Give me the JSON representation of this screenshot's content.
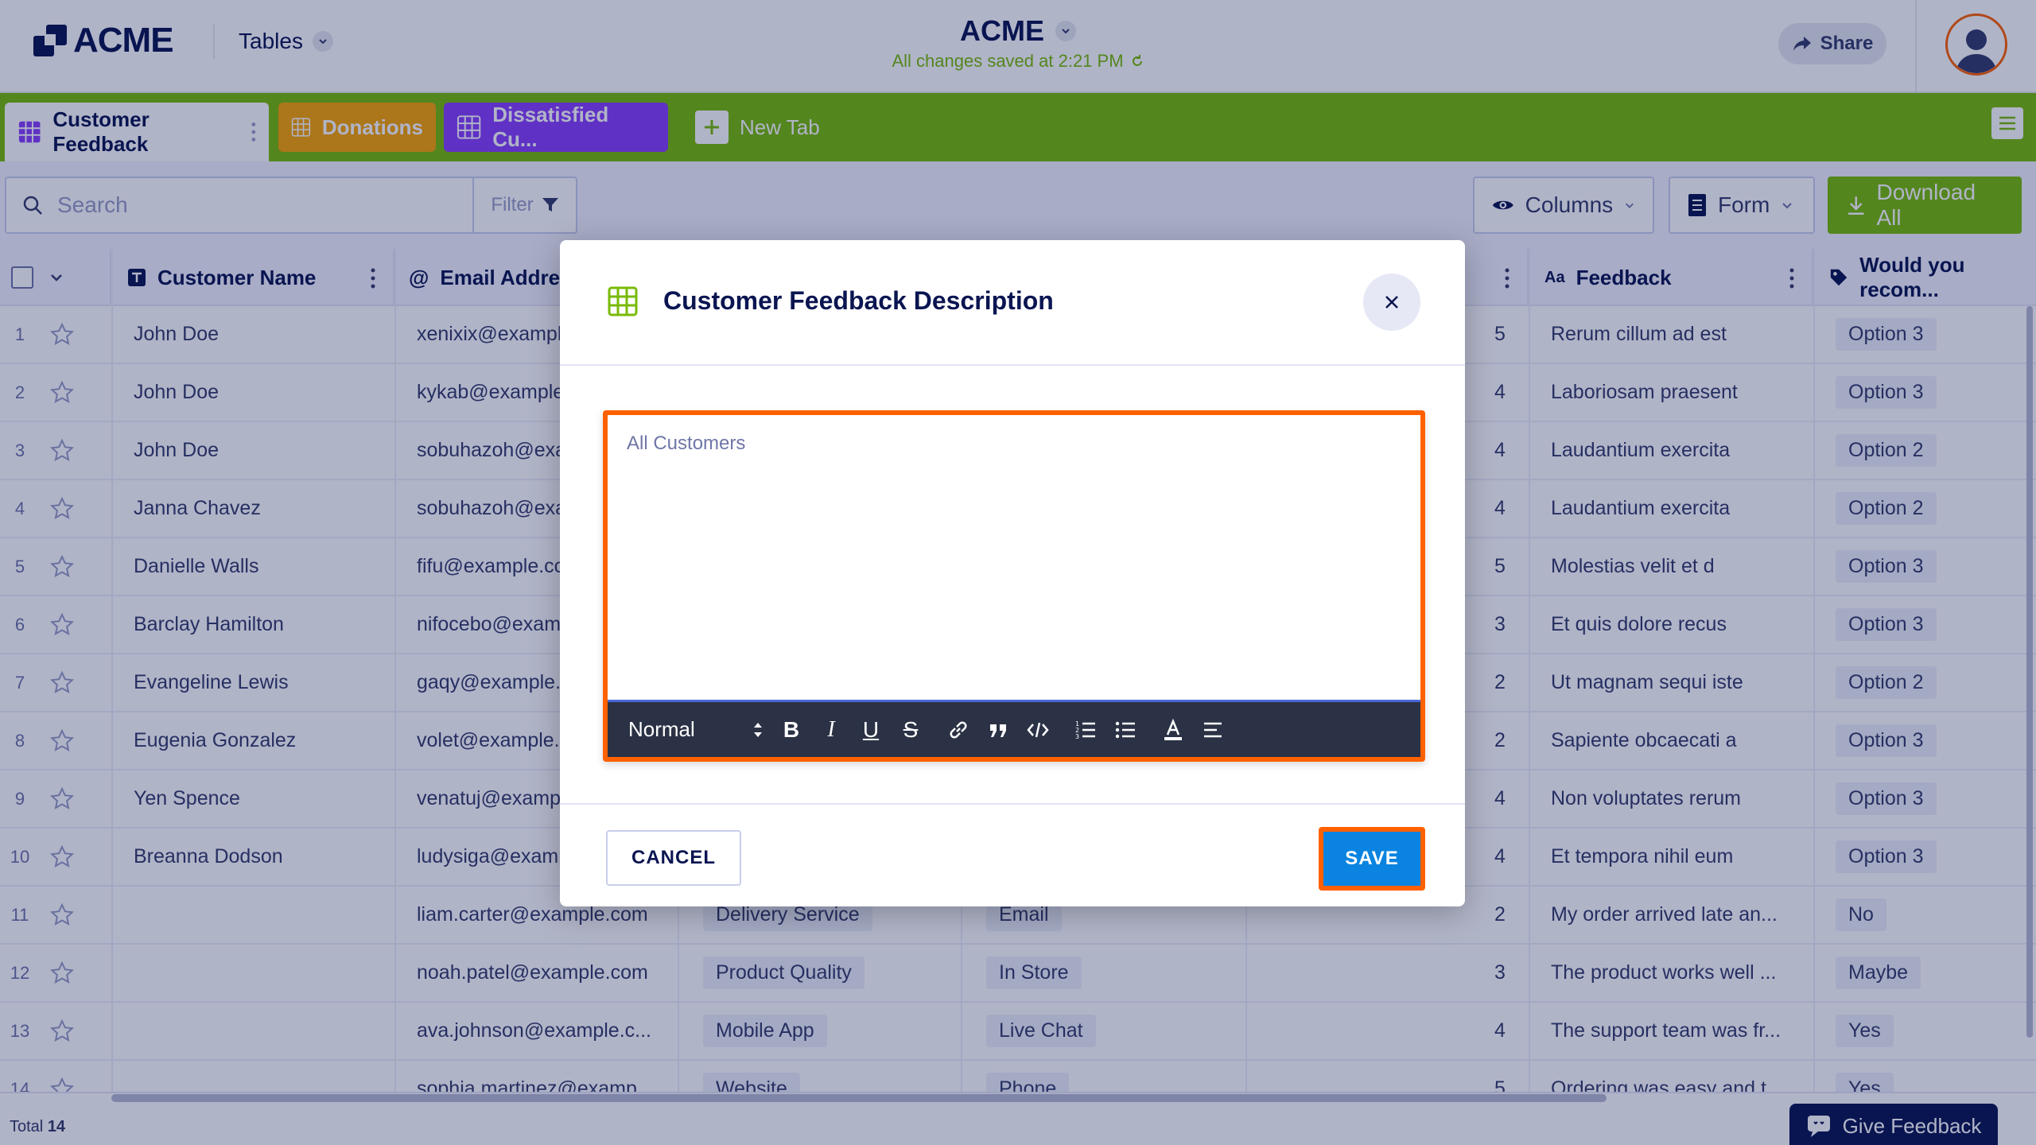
{
  "header": {
    "logo_text": "ACME",
    "tables_label": "Tables",
    "app_name": "ACME",
    "save_status": "All changes saved at 2:21 PM",
    "share_label": "Share"
  },
  "tabs": [
    {
      "label": "Customer Feedback",
      "color": "#ffffff"
    },
    {
      "label": "Donations",
      "color": "#f9a400"
    },
    {
      "label": "Dissatisfied Cu...",
      "color": "#8a3ffc"
    },
    {
      "label": "New Tab"
    }
  ],
  "toolbar": {
    "search_placeholder": "Search",
    "filter_label": "Filter",
    "columns_label": "Columns",
    "form_label": "Form",
    "download_label": "Download All"
  },
  "table": {
    "headers": {
      "customer_name": "Customer Name",
      "email": "Email Address",
      "feedback": "Feedback",
      "recommend": "Would you recom..."
    },
    "rows": [
      {
        "n": "1",
        "name": "John Doe",
        "email": "xenixix@exampl",
        "c3": "",
        "c4": "",
        "rating": "5",
        "feedback": "Rerum cillum ad est",
        "rec": "Option 3"
      },
      {
        "n": "2",
        "name": "John Doe",
        "email": "kykab@example",
        "c3": "",
        "c4": "",
        "rating": "4",
        "feedback": "Laboriosam praesent",
        "rec": "Option 3"
      },
      {
        "n": "3",
        "name": "John Doe",
        "email": "sobuhazoh@exa",
        "c3": "",
        "c4": "",
        "rating": "4",
        "feedback": "Laudantium exercita",
        "rec": "Option 2"
      },
      {
        "n": "4",
        "name": "Janna Chavez",
        "email": "sobuhazoh@exa",
        "c3": "",
        "c4": "",
        "rating": "4",
        "feedback": "Laudantium exercita",
        "rec": "Option 2"
      },
      {
        "n": "5",
        "name": "Danielle Walls",
        "email": "fifu@example.cc",
        "c3": "",
        "c4": "",
        "rating": "5",
        "feedback": "Molestias velit et d",
        "rec": "Option 3"
      },
      {
        "n": "6",
        "name": "Barclay Hamilton",
        "email": "nifocebo@exam",
        "c3": "",
        "c4": "",
        "rating": "3",
        "feedback": "Et quis dolore recus",
        "rec": "Option 3"
      },
      {
        "n": "7",
        "name": "Evangeline Lewis",
        "email": "gaqy@example.",
        "c3": "",
        "c4": "",
        "rating": "2",
        "feedback": "Ut magnam sequi iste",
        "rec": "Option 2"
      },
      {
        "n": "8",
        "name": "Eugenia Gonzalez",
        "email": "volet@example.",
        "c3": "",
        "c4": "",
        "rating": "2",
        "feedback": "Sapiente obcaecati a",
        "rec": "Option 3"
      },
      {
        "n": "9",
        "name": "Yen Spence",
        "email": "venatuj@exampl",
        "c3": "",
        "c4": "",
        "rating": "4",
        "feedback": "Non voluptates rerum",
        "rec": "Option 3"
      },
      {
        "n": "10",
        "name": "Breanna Dodson",
        "email": "ludysiga@examp",
        "c3": "",
        "c4": "",
        "rating": "4",
        "feedback": "Et tempora nihil eum",
        "rec": "Option 3"
      },
      {
        "n": "11",
        "name": "",
        "email": "liam.carter@example.com",
        "c3": "Delivery Service",
        "c4": "Email",
        "rating": "2",
        "feedback": "My order arrived late an...",
        "rec": "No"
      },
      {
        "n": "12",
        "name": "",
        "email": "noah.patel@example.com",
        "c3": "Product Quality",
        "c4": "In Store",
        "rating": "3",
        "feedback": "The product works well ...",
        "rec": "Maybe"
      },
      {
        "n": "13",
        "name": "",
        "email": "ava.johnson@example.c...",
        "c3": "Mobile App",
        "c4": "Live Chat",
        "rating": "4",
        "feedback": "The support team was fr...",
        "rec": "Yes"
      },
      {
        "n": "14",
        "name": "",
        "email": "sophia.martinez@examp...",
        "c3": "Website",
        "c4": "Phone",
        "rating": "5",
        "feedback": "Ordering was easy and t...",
        "rec": "Yes"
      }
    ]
  },
  "footer": {
    "total_label": "Total",
    "total_count": "14",
    "give_feedback": "Give Feedback"
  },
  "modal": {
    "title": "Customer Feedback Description",
    "editor_text": "All Customers",
    "format_select": "Normal",
    "cancel_label": "CANCEL",
    "save_label": "SAVE"
  },
  "colors": {
    "brand_navy": "#0a1551",
    "tab_bar_green": "#78bb07",
    "highlight_orange": "#ff6100",
    "save_blue": "#0a84e0"
  }
}
